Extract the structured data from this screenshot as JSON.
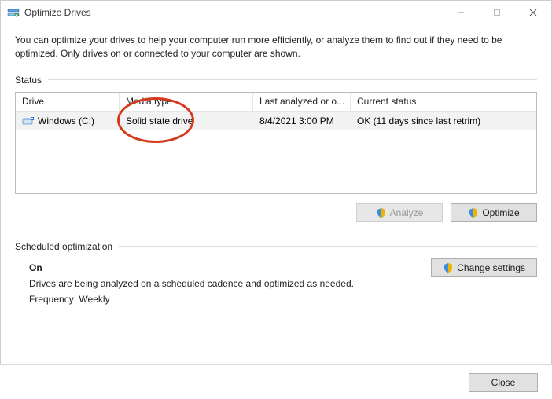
{
  "window": {
    "title": "Optimize Drives"
  },
  "intro": "You can optimize your drives to help your computer run more efficiently, or analyze them to find out if they need to be optimized. Only drives on or connected to your computer are shown.",
  "status": {
    "label": "Status",
    "columns": {
      "drive": "Drive",
      "media": "Media type",
      "last": "Last analyzed or o...",
      "current": "Current status"
    },
    "rows": [
      {
        "drive": "Windows (C:)",
        "media": "Solid state drive",
        "last": "8/4/2021 3:00 PM",
        "current": "OK (11 days since last retrim)"
      }
    ]
  },
  "buttons": {
    "analyze": "Analyze",
    "optimize": "Optimize",
    "change_settings": "Change settings",
    "close": "Close"
  },
  "sched": {
    "label": "Scheduled optimization",
    "on": "On",
    "desc": "Drives are being analyzed on a scheduled cadence and optimized as needed.",
    "freq": "Frequency: Weekly"
  }
}
